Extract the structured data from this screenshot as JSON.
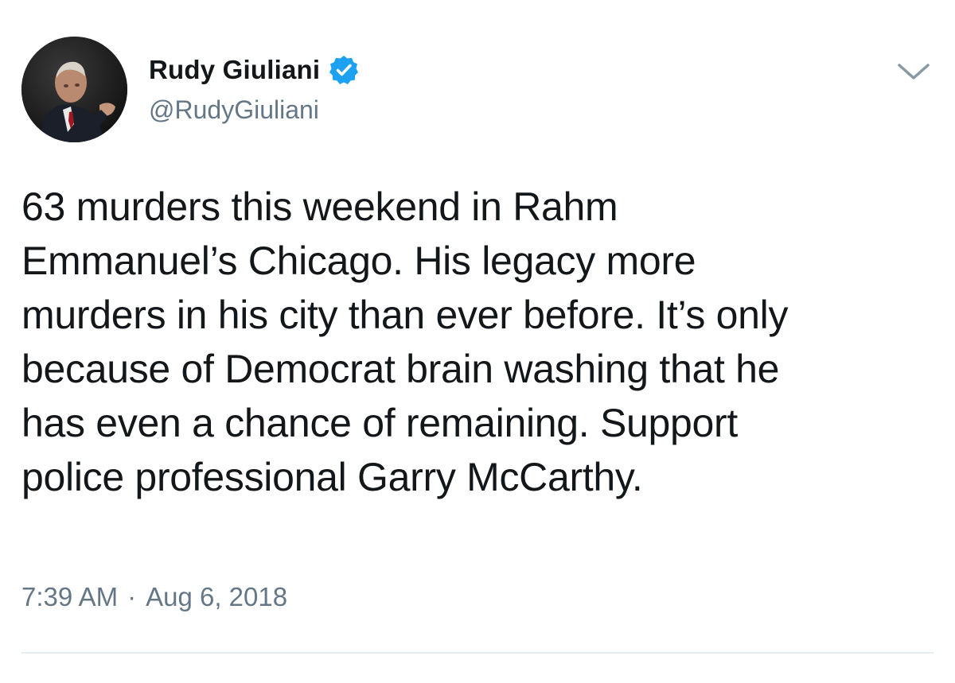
{
  "author": {
    "display_name": "Rudy Giuliani",
    "handle": "@RudyGiuliani",
    "verified": true,
    "avatar_icon": "profile-photo-icon",
    "verified_icon": "verified-badge-icon"
  },
  "tweet": {
    "text": "63 murders this weekend in Rahm\nEmmanuel’s Chicago. His legacy more\nmurders in his city than ever before. It’s only\nbecause of Democrat brain washing that he\nhas even a chance of remaining. Support\npolice professional Garry McCarthy.",
    "time": "7:39 AM",
    "separator": "·",
    "date": "Aug 6, 2018"
  },
  "menu": {
    "icon": "chevron-down-icon"
  },
  "colors": {
    "text_primary": "#14171a",
    "text_secondary": "#657786",
    "verified_blue": "#1da1f2",
    "divider": "#e6ecf0"
  }
}
